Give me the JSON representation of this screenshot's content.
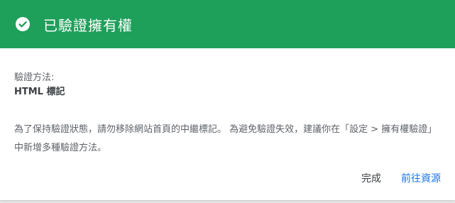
{
  "dialog": {
    "header": {
      "title": "已驗證擁有權",
      "icon": "check-circle-icon",
      "background_color": "#1e9f5a"
    },
    "method_label": "驗證方法:",
    "method_value": "HTML 標記",
    "message": "為了保持驗證狀態，請勿移除網站首頁的中繼標記。 為避免驗證失效，建議你在「設定 > 擁有權驗證」中新增多種驗證方法。",
    "actions": {
      "done_label": "完成",
      "go_to_resource_label": "前往資源"
    }
  }
}
